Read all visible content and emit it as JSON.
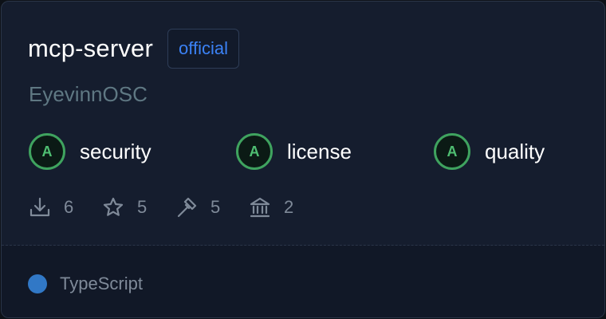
{
  "card": {
    "title": "mcp-server",
    "badge": "official",
    "owner": "EyevinnOSC"
  },
  "scores": [
    {
      "grade": "A",
      "label": "security"
    },
    {
      "grade": "A",
      "label": "license"
    },
    {
      "grade": "A",
      "label": "quality"
    }
  ],
  "stats": [
    {
      "icon": "download-icon",
      "value": "6"
    },
    {
      "icon": "star-icon",
      "value": "5"
    },
    {
      "icon": "hammer-icon",
      "value": "5"
    },
    {
      "icon": "bank-icon",
      "value": "2"
    }
  ],
  "language": {
    "name": "TypeScript",
    "color": "#3178c6"
  },
  "colors": {
    "accent": "#3b82f6",
    "grade_green": "#3fa35f",
    "background": "#151d2e"
  }
}
